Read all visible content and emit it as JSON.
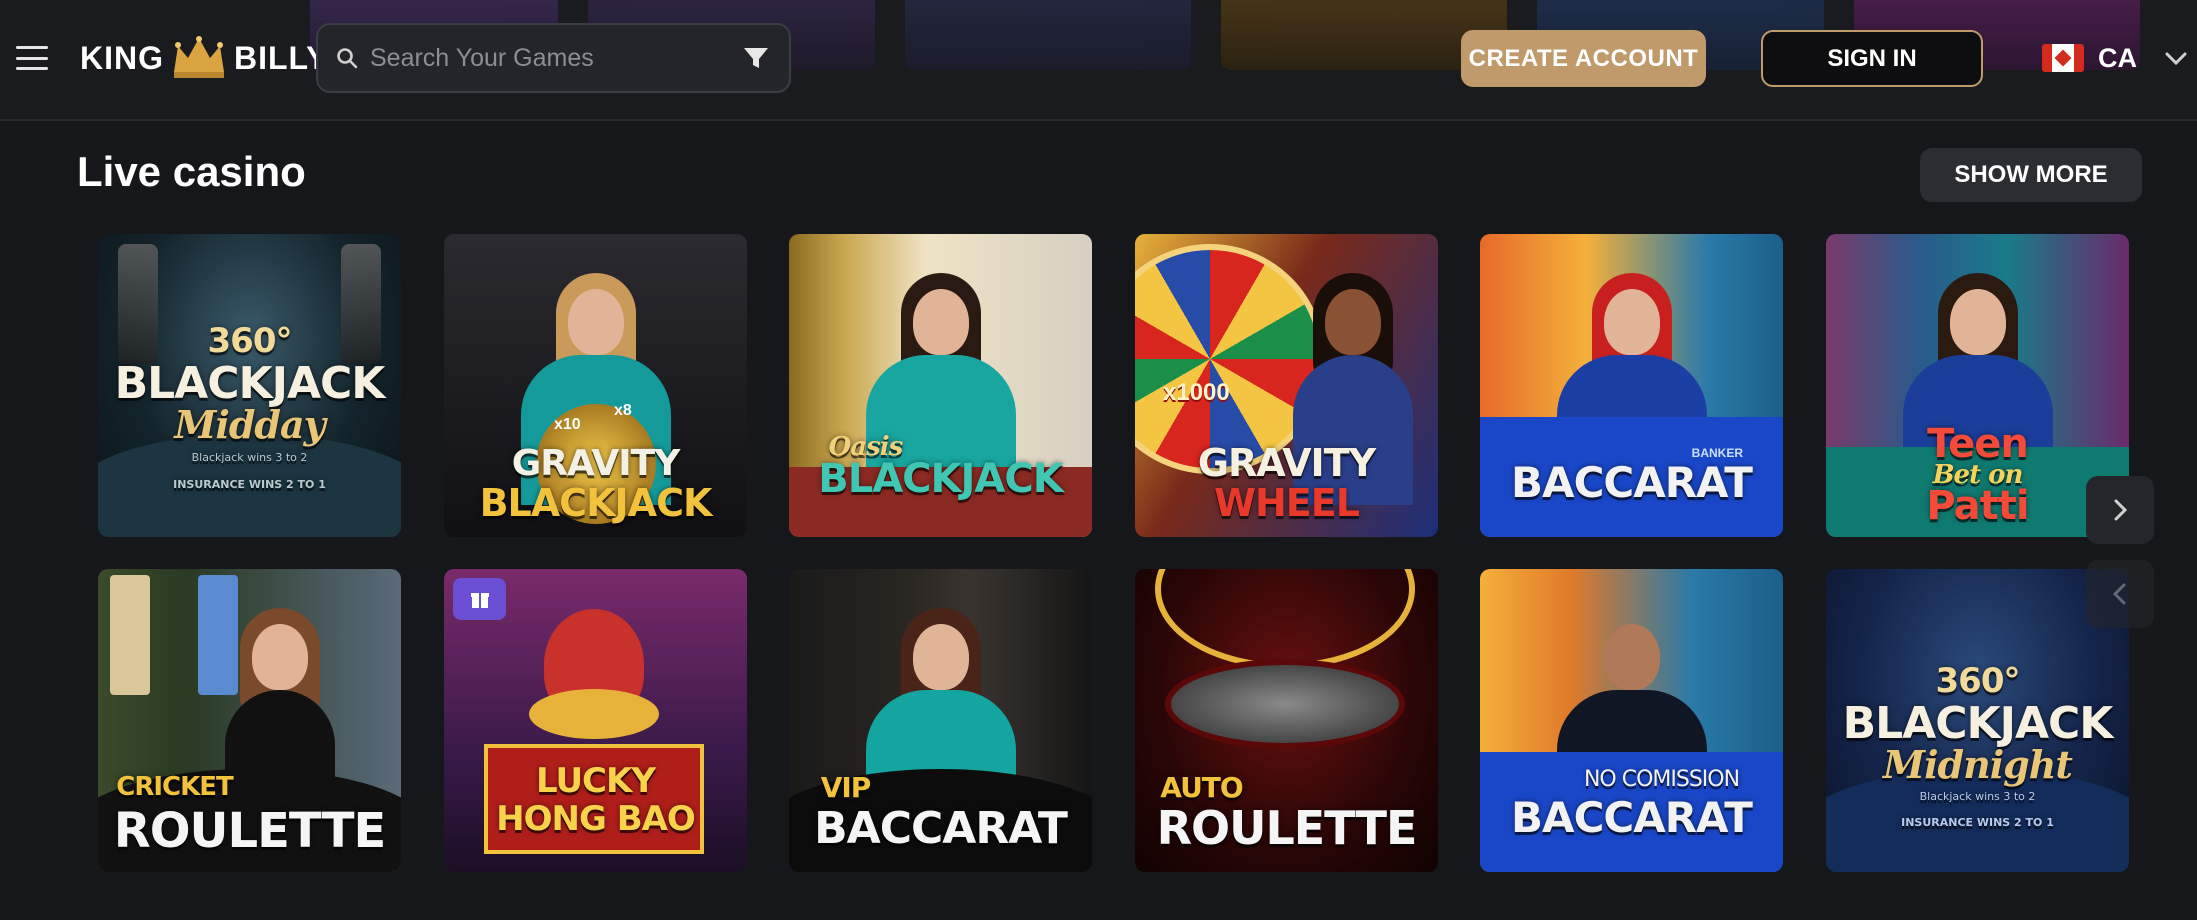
{
  "header": {
    "logo_left": "KING",
    "logo_right": "BILLY",
    "search_placeholder": "Search Your Games",
    "create_account": "CREATE ACCOUNT",
    "sign_in": "SIGN IN",
    "language_code": "CA",
    "icons": [
      "menu-icon",
      "crown-icon",
      "search-icon",
      "filter-icon",
      "canada-flag-icon",
      "chevron-down-icon"
    ]
  },
  "section": {
    "title": "Live casino",
    "show_more": "SHOW MORE"
  },
  "games": [
    {
      "line1": "360°",
      "line2": "BLACKJACK",
      "line3": "Midday",
      "small": "Blackjack wins 3 to 2",
      "small2": "INSURANCE WINS 2 TO 1"
    },
    {
      "line1": "GRAVITY",
      "line2": "BLACKJACK",
      "x10": "x10",
      "x8": "x8"
    },
    {
      "line1": "Oasis",
      "line2": "BLACKJACK"
    },
    {
      "line1": "GRAVITY",
      "line2": "WHEEL",
      "badge": "x1000"
    },
    {
      "line1": "BACCARAT",
      "banker": "BANKER"
    },
    {
      "line1": "Teen",
      "line2": "Bet on",
      "line3": "Patti"
    },
    {
      "line1": "CRICKET",
      "line2": "ROULETTE"
    },
    {
      "line1": "LUCKY",
      "line2": "HONG BAO"
    },
    {
      "line1": "VIP",
      "line2": "BACCARAT"
    },
    {
      "line1": "AUTO",
      "line2": "ROULETTE"
    },
    {
      "line1": "NO COMISSION",
      "line2": "BACCARAT"
    },
    {
      "line1": "360°",
      "line2": "BLACKJACK",
      "line3": "Midnight",
      "small": "Blackjack wins 3 to 2",
      "small2": "INSURANCE WINS 2 TO 1"
    }
  ],
  "nav": {
    "next_icon": "chevron-right-icon",
    "prev_icon": "chevron-left-icon"
  },
  "colors": {
    "background": "#16171b",
    "accent": "#c19a6b",
    "header": "#1a1b1f"
  }
}
